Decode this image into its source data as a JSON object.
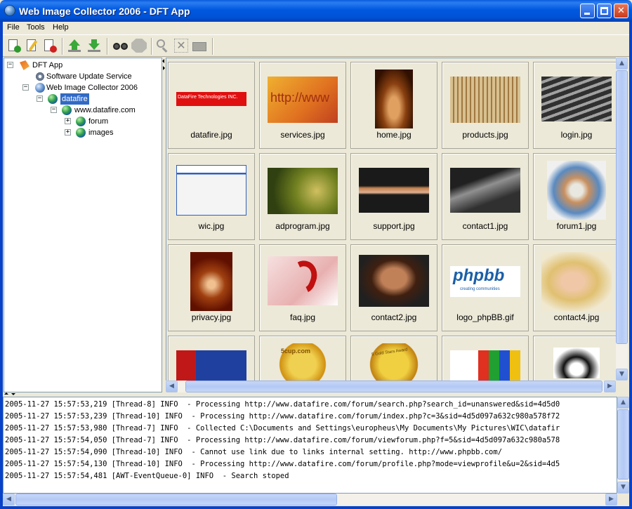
{
  "window": {
    "title": "Web Image Collector 2006 - DFT App"
  },
  "menu": {
    "file": "File",
    "tools": "Tools",
    "help": "Help"
  },
  "toolbar": {
    "icons": [
      "new-project-icon",
      "edit-project-icon",
      "delete-project-icon",
      "upload-icon",
      "download-icon",
      "binoculars-icon",
      "stop-icon",
      "zoom-icon",
      "clear-icon",
      "folder-icon"
    ]
  },
  "tree": [
    {
      "label": "DFT App",
      "icon": "app-icon",
      "expander": "−"
    },
    {
      "label": "Software Update Service",
      "icon": "update-icon"
    },
    {
      "label": "Web Image Collector 2006",
      "icon": "collector-icon",
      "expander": "−"
    },
    {
      "label": "datafire",
      "icon": "globe-icon",
      "expander": "−",
      "selected": true
    },
    {
      "label": "www.datafire.com",
      "icon": "globe-icon",
      "expander": "−"
    },
    {
      "label": "forum",
      "icon": "globe-icon",
      "expander": "+"
    },
    {
      "label": "images",
      "icon": "globe-icon",
      "expander": "+"
    }
  ],
  "thumbnails": [
    {
      "label": "datafire.jpg"
    },
    {
      "label": "services.jpg"
    },
    {
      "label": "home.jpg"
    },
    {
      "label": "products.jpg"
    },
    {
      "label": "login.jpg"
    },
    {
      "label": "wic.jpg"
    },
    {
      "label": "adprogram.jpg"
    },
    {
      "label": "support.jpg"
    },
    {
      "label": "contact1.jpg"
    },
    {
      "label": "forum1.jpg"
    },
    {
      "label": "privacy.jpg"
    },
    {
      "label": "faq.jpg"
    },
    {
      "label": "contact2.jpg"
    },
    {
      "label": "logo_phpBB.gif"
    },
    {
      "label": "contact4.jpg"
    },
    {
      "label": ""
    },
    {
      "label": ""
    },
    {
      "label": ""
    },
    {
      "label": ""
    },
    {
      "label": ""
    }
  ],
  "thumb_text": {
    "datafire": "DataFire Technologies INC.",
    "services": "http://www",
    "phpbb": "phpbb",
    "phpbb_sub": "creating communities",
    "badge": "5cup.com",
    "award": "5 Gold Stars Award"
  },
  "log": [
    "2005-11-27 15:57:53,219 [Thread-8] INFO  - Processing http://www.datafire.com/forum/search.php?search_id=unanswered&sid=4d5d0",
    "2005-11-27 15:57:53,239 [Thread-10] INFO  - Processing http://www.datafire.com/forum/index.php?c=3&sid=4d5d097a632c980a578f72",
    "2005-11-27 15:57:53,980 [Thread-7] INFO  - Collected C:\\Documents and Settings\\europheus\\My Documents\\My Pictures\\WIC\\datafir",
    "2005-11-27 15:57:54,050 [Thread-7] INFO  - Processing http://www.datafire.com/forum/viewforum.php?f=5&sid=4d5d097a632c980a578",
    "2005-11-27 15:57:54,090 [Thread-10] INFO  - Cannot use link due to links internal setting. http://www.phpbb.com/",
    "2005-11-27 15:57:54,130 [Thread-10] INFO  - Processing http://www.datafire.com/forum/profile.php?mode=viewprofile&u=2&sid=4d5",
    "2005-11-27 15:57:54,481 [AWT-EventQueue-0] INFO  - Search stoped"
  ]
}
